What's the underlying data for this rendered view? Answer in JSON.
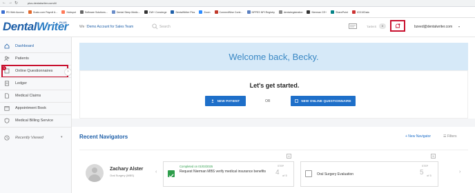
{
  "browser": {
    "url": "plus.dentalwriter.com/#/",
    "bookmarks": [
      {
        "label": "PD Web Access",
        "color": "#3c6fd1"
      },
      {
        "label": "Gusto.com Payroll &...",
        "color": "#e0682b"
      },
      {
        "label": "Hubspot",
        "color": "#ff7a59"
      },
      {
        "label": "Software Solutions...",
        "color": "#666666"
      },
      {
        "label": "Dental Sleep Medic...",
        "color": "#6b8ec9"
      },
      {
        "label": "DW+ Concierge",
        "color": "#333333"
      },
      {
        "label": "DentalWriter Plus",
        "color": "#1e5fa8"
      },
      {
        "label": "Zoom",
        "color": "#2d8cff"
      },
      {
        "label": "ConnectWise Contr...",
        "color": "#c0392b"
      },
      {
        "label": "NPPES NPI Registry",
        "color": "#5a7fbf"
      },
      {
        "label": "dentalregistration",
        "color": "#888888"
      },
      {
        "label": "Nierman CE+",
        "color": "#333333"
      },
      {
        "label": "SharePoint",
        "color": "#038387"
      },
      {
        "label": "ICD10Data",
        "color": "#cc3333"
      }
    ]
  },
  "header": {
    "logo_dental": "Dental",
    "logo_writer": "Writer",
    "logo_plus": "PLUS",
    "team_prefix": "We ♡",
    "team_name": "Demo Account for Sales Team",
    "search_placeholder": "Search",
    "tasks_label": "TASKS",
    "tasks_count": "0",
    "user_email": "bzeed@dentalwriter.com",
    "user_caret": "▾"
  },
  "sidebar": {
    "collapse": "›",
    "items": [
      {
        "label": "Dashboard",
        "icon": "home-icon"
      },
      {
        "label": "Patients",
        "icon": "patients-icon"
      },
      {
        "label": "Online Questionnaires",
        "icon": "questionnaire-icon",
        "badge": "1"
      },
      {
        "label": "Ledger",
        "icon": "ledger-icon"
      },
      {
        "label": "Medical Claims",
        "icon": "claims-icon"
      },
      {
        "label": "Appointment Book",
        "icon": "calendar-icon"
      },
      {
        "label": "Medical Billing Service",
        "icon": "shield-icon"
      },
      {
        "label": "Recently Viewed",
        "icon": "clock-icon"
      }
    ]
  },
  "main": {
    "welcome": "Welcome back, Becky.",
    "get_started": "Let's get started.",
    "new_patient": "NEW PATIENT",
    "or": "OR",
    "new_questionnaire": "NEW ONLINE QUESTIONNAIRE",
    "recent_title": "Recent Navigators",
    "new_navigator": "+ New Navigator",
    "filters": "Filters",
    "navigator": {
      "patient_name": "Zachary Alster",
      "specialty": "Oral Surgery (MBS)",
      "card1": {
        "completed": "Completed on 01/03/2025",
        "text": "Request Nierman MBS verify medical insurance benefits",
        "step_label": "STEP",
        "step": "4",
        "of": "of 5",
        "box": "4"
      },
      "card2": {
        "text": "Oral Surgery Evaluation",
        "step_label": "STEP",
        "step": "5",
        "of": "of 5",
        "box": "5"
      }
    }
  },
  "colors": {
    "brand": "#1e5fa8",
    "button": "#1e6fc9",
    "welcome_bg": "#d6e9f8",
    "highlight": "#c8102e",
    "success": "#2e9e4b"
  }
}
